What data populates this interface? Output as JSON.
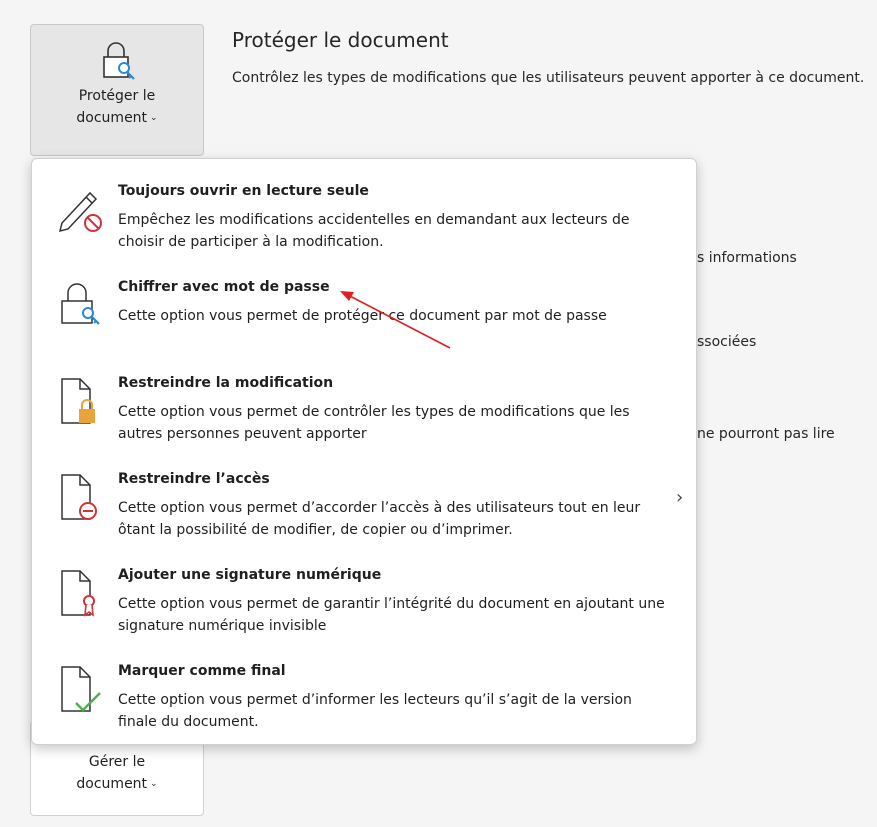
{
  "protect_button": {
    "label_line1": "Protéger le",
    "label_line2": "document",
    "chevron": "⌄"
  },
  "section": {
    "title": "Protéger le document",
    "description": "Contrôlez les types de modifications que les utilisateurs peuvent apporter à ce document."
  },
  "background_fragments": [
    "s informations",
    "ssociées",
    "ne pourront pas lire"
  ],
  "manage_button": {
    "label_line1": "Gérer le",
    "label_line2": "document",
    "chevron": "⌄"
  },
  "menu": {
    "items": [
      {
        "title": "Toujours ouvrir en lecture seule",
        "description": "Empêchez les modifications accidentelles en demandant aux lecteurs de choisir de participer à la modification.",
        "icon": "pencil-no-icon"
      },
      {
        "title": "Chiffrer avec mot de passe",
        "description": "Cette option vous permet de protéger ce document par mot de passe",
        "icon": "lock-key-icon"
      },
      {
        "title": "Restreindre la modification",
        "description": "Cette option vous permet de contrôler les types de modifications que les autres personnes peuvent apporter",
        "icon": "document-lock-icon"
      },
      {
        "title": "Restreindre l’accès",
        "description": "Cette option vous permet d’accorder l’accès à des utilisateurs tout en leur ôtant la possibilité de modifier, de copier ou d’imprimer.",
        "icon": "document-restricted-icon",
        "submenu_chevron": "›"
      },
      {
        "title": "Ajouter une signature numérique",
        "description": "Cette option vous permet de garantir l’intégrité du document en ajoutant une signature numérique invisible",
        "icon": "document-ribbon-icon"
      },
      {
        "title": "Marquer comme final",
        "description": "Cette option vous permet d’informer les lecteurs qu’il s’agit de la version finale du document.",
        "icon": "document-check-icon"
      }
    ]
  },
  "colors": {
    "annotation_arrow": "#e02020",
    "key_blue": "#2b88d8",
    "lock_gold": "#e8a33d",
    "no_red": "#d13438",
    "check_green": "#4caf50"
  }
}
